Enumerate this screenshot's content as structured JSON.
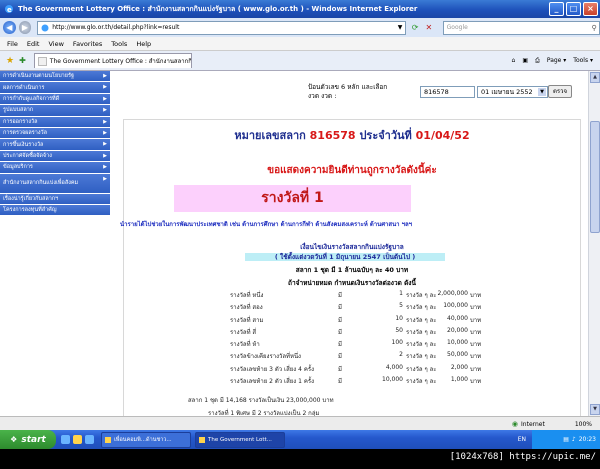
{
  "window": {
    "title": "The Government Lottery Office : สำนักงานสลากกินแบ่งรัฐบาล ( www.glo.or.th ) - Windows Internet Explorer",
    "minimize": "_",
    "maximize": "□",
    "close": "×"
  },
  "address": {
    "url": "http://www.glo.or.th/detail.php?link=result",
    "search_placeholder": "Google"
  },
  "menu": [
    "File",
    "Edit",
    "View",
    "Favorites",
    "Tools",
    "Help"
  ],
  "tab": {
    "label": "The Government Lottery Office : สำนักงานสลากกินแบ่ง...",
    "tools": [
      "Page ▾",
      "Tools ▾"
    ]
  },
  "sidebar": {
    "items": [
      "การดำเนินงานตามนโยบายรัฐ",
      "ผลการดำเนินการ",
      "การกำกับดูแลกิจการที่ดี",
      "รูปแบบสลาก",
      "การออกรางวัล",
      "การตรวจผลรางวัล",
      "การขึ้นเงินรางวัล",
      "ประกาศจัดซื้อจัดจ้าง",
      "ข้อมูลบริการ",
      "สำนักงานสลากกินแบ่งเพื่อสังคม",
      "เรื่องน่ารู้เกี่ยวกับสลากฯ",
      "โครงการลงทุนที่สำคัญ"
    ]
  },
  "form": {
    "label": "ป้อนตัวเลข 6 หลัก และเลือกงวด งวด :",
    "number_value": "816578",
    "date_value": "01 เมษายน 2552",
    "button": "ตรวจ"
  },
  "result": {
    "heading_prefix": "หมายเลขสลาก",
    "number": "816578",
    "heading_mid": "ประจำวันที่",
    "date": "01/04/52",
    "congrats": "ขอแสดงความยินดีท่านถูกรางวัลดังนี้ค่ะ",
    "prize_title": "รางวัลที่ 1",
    "blue_line": "นำรายได้ไปช่วยในการพัฒนาประเทศชาติ เช่น ด้านการศึกษา ด้านการกีฬา ด้านสังคมสงเคราะห์ ด้านศาสนา ฯลฯ",
    "cond1": "เงื่อนไขเงินรางวัลสลากกินแบ่งรัฐบาล",
    "cond2": "( ใช้ตั้งแต่งวดวันที่ 1 มิถุนายน 2547 เป็นต้นไป )",
    "cond3": "สลาก 1 ชุด มี 1 ล้านฉบับๆ ละ 40 บาท",
    "cond4": "ถ้าจำหน่ายหมด กำหนดเงินรางวัลต่องวด ดังนี้",
    "prizes": [
      {
        "name": "รางวัลที่ หนึ่ง",
        "mi": "มี",
        "count": "1",
        "unit": "รางวัล ๆ ละ",
        "amount": "2,000,000",
        "baht": "บาท"
      },
      {
        "name": "รางวัลที่ สอง",
        "mi": "มี",
        "count": "5",
        "unit": "รางวัล ๆ ละ",
        "amount": "100,000",
        "baht": "บาท"
      },
      {
        "name": "รางวัลที่ สาม",
        "mi": "มี",
        "count": "10",
        "unit": "รางวัล ๆ ละ",
        "amount": "40,000",
        "baht": "บาท"
      },
      {
        "name": "รางวัลที่ สี่",
        "mi": "มี",
        "count": "50",
        "unit": "รางวัล ๆ ละ",
        "amount": "20,000",
        "baht": "บาท"
      },
      {
        "name": "รางวัลที่ ห้า",
        "mi": "มี",
        "count": "100",
        "unit": "รางวัล ๆ ละ",
        "amount": "10,000",
        "baht": "บาท"
      },
      {
        "name": "รางวัลข้างเคียงรางวัลที่หนึ่ง",
        "mi": "มี",
        "count": "2",
        "unit": "รางวัล ๆ ละ",
        "amount": "50,000",
        "baht": "บาท"
      },
      {
        "name": "รางวัลเลขท้าย 3 ตัว เสี่ยง 4 ครั้ง",
        "mi": "มี",
        "count": "4,000",
        "unit": "รางวัล ๆ ละ",
        "amount": "2,000",
        "baht": "บาท"
      },
      {
        "name": "รางวัลเลขท้าย 2 ตัว เสี่ยง 1 ครั้ง",
        "mi": "มี",
        "count": "10,000",
        "unit": "รางวัล ๆ ละ",
        "amount": "1,000",
        "baht": "บาท"
      }
    ],
    "foot1": "สลาก 1 ชุด มี 14,168 รางวัลเป็นเงิน 23,000,000 บาท",
    "foot2": "รางวัลที่ 1 พิเศษ มี 2 รางวัลแบ่งเป็น 2 กลุ่ม"
  },
  "status": {
    "zone": "Internet",
    "zoom": "100%"
  },
  "taskbar": {
    "start": "start",
    "items": [
      "เพื่อนคอมพิ...ด้านชาว...",
      "The Government Lott..."
    ],
    "lang": "EN",
    "clock": "20:23"
  },
  "watermark": "[1024x768] https://upic.me/"
}
